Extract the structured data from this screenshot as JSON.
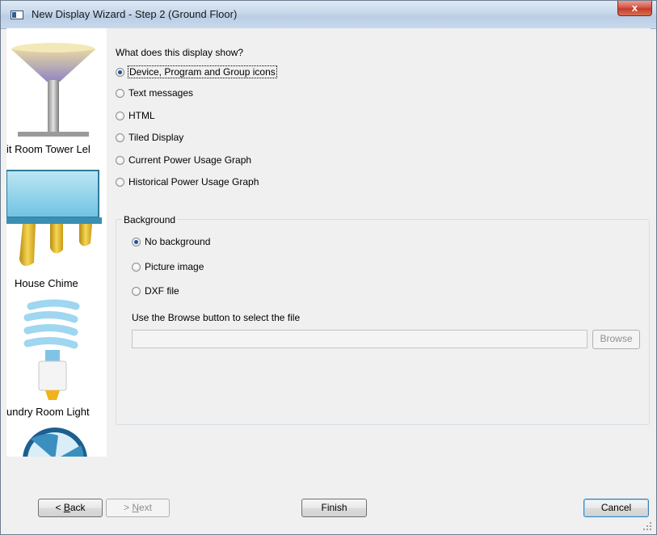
{
  "window": {
    "title": "New Display Wizard - Step 2 (Ground Floor)",
    "close_glyph": "x"
  },
  "devices": [
    {
      "label": "it Room Tower Lel",
      "icon": "torchiere-lamp-icon"
    },
    {
      "label": "House Chime",
      "icon": "chime-icon"
    },
    {
      "label": "undry Room Light",
      "icon": "cfl-bulb-icon"
    },
    {
      "label": "",
      "icon": "fan-icon"
    }
  ],
  "question": {
    "label": "What does this display show?",
    "options": [
      {
        "label": "Device, Program and Group icons",
        "checked": true
      },
      {
        "label": "Text messages",
        "checked": false
      },
      {
        "label": "HTML",
        "checked": false
      },
      {
        "label": "Tiled Display",
        "checked": false
      },
      {
        "label": "Current Power Usage Graph",
        "checked": false
      },
      {
        "label": "Historical Power Usage Graph",
        "checked": false
      }
    ]
  },
  "background": {
    "title": "Background",
    "options": [
      {
        "label": "No background",
        "checked": true
      },
      {
        "label": "Picture image",
        "checked": false
      },
      {
        "label": "DXF file",
        "checked": false
      }
    ],
    "browse_hint": "Use the Browse button to select the file",
    "file_value": "",
    "browse_label": "Browse"
  },
  "buttons": {
    "back_prefix": "< ",
    "back_mnemonic": "B",
    "back_rest": "ack",
    "next_prefix": "> ",
    "next_mnemonic": "N",
    "next_rest": "ext",
    "finish": "Finish",
    "cancel": "Cancel"
  },
  "colors": {
    "selected_radio": "#1f4fa5",
    "close_button": "#c43c2c",
    "titlebar": "#c6d7ea"
  }
}
